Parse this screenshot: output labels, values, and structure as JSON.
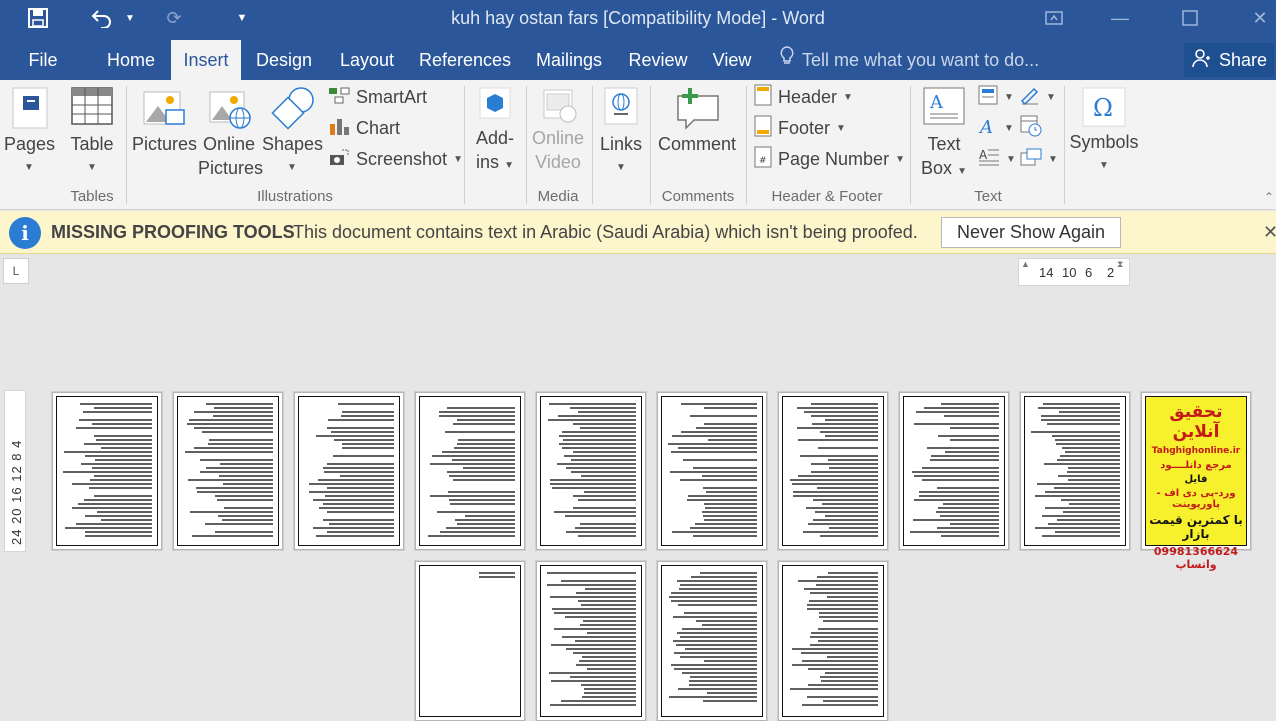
{
  "titlebar": {
    "title": "kuh hay ostan fars [Compatibility Mode] - Word",
    "save_icon": "save-icon",
    "undo_icon": "undo-icon",
    "redo_icon": "redo-icon",
    "customize_icon": "customize-qat-icon"
  },
  "tabs": {
    "file": "File",
    "home": "Home",
    "insert": "Insert",
    "design": "Design",
    "layout": "Layout",
    "references": "References",
    "mailings": "Mailings",
    "review": "Review",
    "view": "View",
    "tell_me": "Tell me what you want to do...",
    "share": "Share"
  },
  "ribbon": {
    "pages": "Pages",
    "table": "Table",
    "pictures": "Pictures",
    "online_pictures_1": "Online",
    "online_pictures_2": "Pictures",
    "shapes": "Shapes",
    "smartart": "SmartArt",
    "chart": "Chart",
    "screenshot": "Screenshot",
    "addins_1": "Add-",
    "addins_2": "ins",
    "online_video_1": "Online",
    "online_video_2": "Video",
    "links": "Links",
    "comment": "Comment",
    "header": "Header",
    "footer": "Footer",
    "page_number": "Page Number",
    "text_box_1": "Text",
    "text_box_2": "Box",
    "symbols": "Symbols",
    "groups": {
      "tables": "Tables",
      "illustrations": "Illustrations",
      "media": "Media",
      "comments": "Comments",
      "header_footer": "Header & Footer",
      "text": "Text"
    }
  },
  "infobar": {
    "title": "MISSING PROOFING TOOLS",
    "message": "This document contains text in Arabic (Saudi Arabia) which isn't being proofed.",
    "button": "Never Show Again"
  },
  "rulers": {
    "corner": "L",
    "h_14": "14",
    "h_10": "10",
    "h_6": "6",
    "h_2": "2",
    "v_labels": "24 20 16 12  8   4"
  },
  "ad_page": {
    "line1": "تحقیق آنلاین",
    "line2": "Tahghighonline.ir",
    "line3": "مرجع دانلــــود",
    "line4": "فایل",
    "line5": "ورد-پی دی اف - پاورپوینت",
    "line6": "با کمترین قیمت بازار",
    "line7": "09981366624 واتساپ"
  },
  "colors": {
    "brand": "#2b579a",
    "infobar_bg": "#fdf5cc",
    "ad_bg": "#f6f12c"
  }
}
